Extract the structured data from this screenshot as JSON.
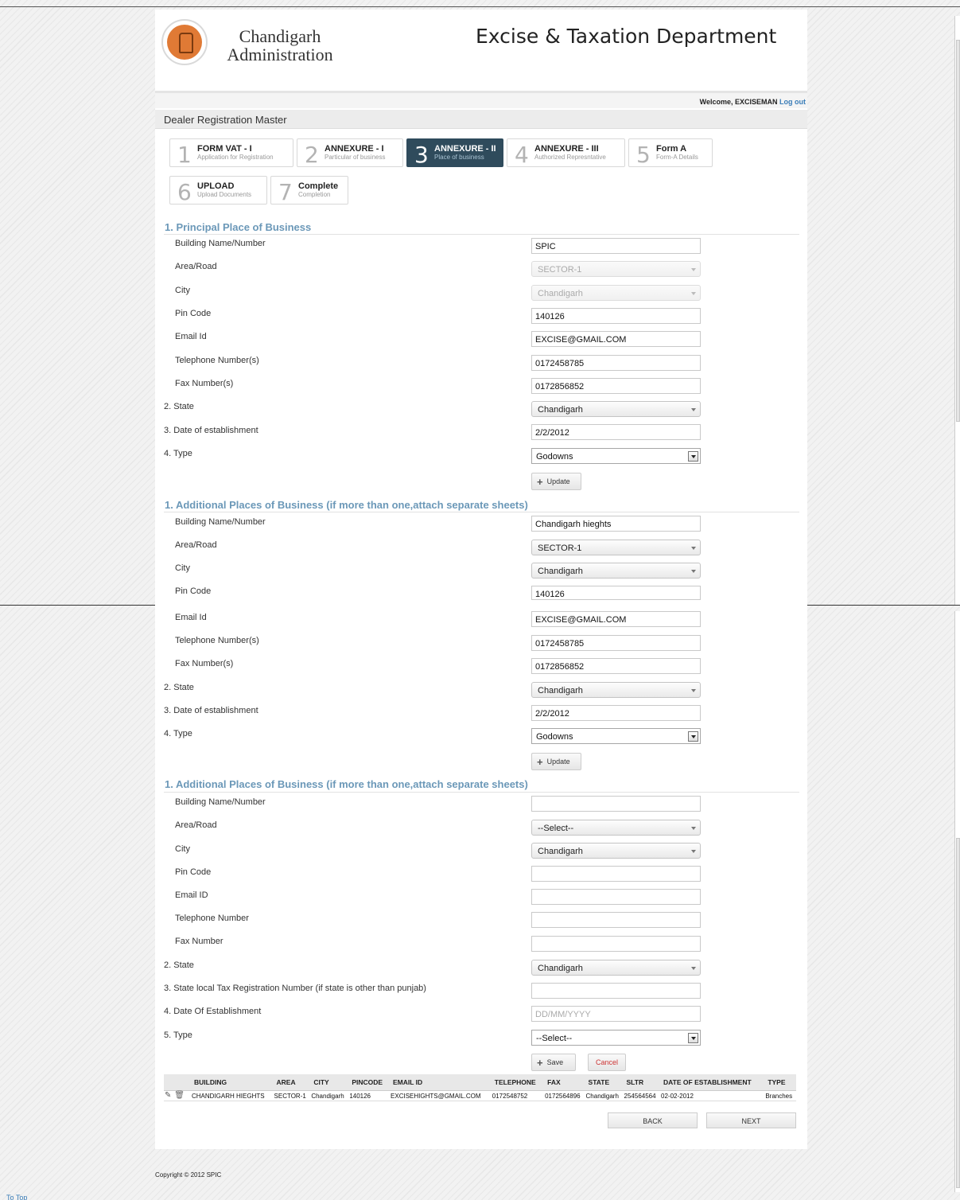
{
  "header": {
    "admin_line1": "Chandigarh",
    "admin_line2": "Administration",
    "department": "Excise & Taxation Department"
  },
  "welcome": {
    "text": "Welcome, EXCISEMAN",
    "logout": "Log out"
  },
  "page_title": "Dealer Registration Master",
  "steps": [
    {
      "num": "1",
      "title": "FORM VAT - I",
      "sub": "Application for Registration"
    },
    {
      "num": "2",
      "title": "ANNEXURE - I",
      "sub": "Particular of business"
    },
    {
      "num": "3",
      "title": "ANNEXURE - II",
      "sub": "Place of business"
    },
    {
      "num": "4",
      "title": "ANNEXURE - III",
      "sub": "Authorized Represntative"
    },
    {
      "num": "5",
      "title": "Form A",
      "sub": "Form-A Details"
    },
    {
      "num": "6",
      "title": "UPLOAD",
      "sub": "Upload Documents"
    },
    {
      "num": "7",
      "title": "Complete",
      "sub": "Completion"
    }
  ],
  "principal": {
    "heading": "1. Principal Place of Business",
    "labels": {
      "building": "Building Name/Number",
      "area": "Area/Road",
      "city": "City",
      "pin": "Pin Code",
      "email": "Email Id",
      "tel": "Telephone Number(s)",
      "fax": "Fax Number(s)",
      "state": "2. State",
      "date": "3. Date of establishment",
      "type": "4. Type"
    },
    "values": {
      "building": "SPIC",
      "area": "SECTOR-1",
      "city": "Chandigarh",
      "pin": "140126",
      "email": "EXCISE@GMAIL.COM",
      "tel": "0172458785",
      "fax": "0172856852",
      "state": "Chandigarh",
      "date": "2/2/2012",
      "type": "Godowns"
    },
    "update": "Update"
  },
  "additional1": {
    "heading": "1. Additional Places of Business (if more than one,attach separate sheets)",
    "labels": {
      "building": "Building Name/Number",
      "area": "Area/Road",
      "city": "City",
      "pin": "Pin Code"
    },
    "values": {
      "building": "Chandigarh hieghts",
      "area": "SECTOR-1",
      "city": "Chandigarh",
      "pin": "140126"
    }
  },
  "continued": {
    "labels": {
      "email": "Email Id",
      "tel": "Telephone Number(s)",
      "fax": "Fax Number(s)",
      "state": "2. State",
      "date": "3. Date of establishment",
      "type": "4. Type"
    },
    "values": {
      "email": "EXCISE@GMAIL.COM",
      "tel": "0172458785",
      "fax": "0172856852",
      "state": "Chandigarh",
      "date": "2/2/2012",
      "type": "Godowns"
    },
    "update": "Update"
  },
  "additional2": {
    "heading": "1. Additional Places of Business (if more than one,attach separate sheets)",
    "labels": {
      "building": "Building Name/Number",
      "area": "Area/Road",
      "city": "City",
      "pin": "Pin Code",
      "email": "Email ID",
      "tel": "Telephone Number",
      "fax": "Fax Number",
      "state": "2. State",
      "sltr": "3. State local Tax Registration Number (if state is other than punjab)",
      "date": "4. Date Of Establishment",
      "type": "5. Type"
    },
    "values": {
      "area": "--Select--",
      "city": "Chandigarh",
      "state": "Chandigarh",
      "type": "--Select--"
    },
    "placeholders": {
      "date": "DD/MM/YYYY"
    },
    "save": "Save",
    "cancel": "Cancel"
  },
  "grid": {
    "headers": [
      "BUILDING",
      "AREA",
      "CITY",
      "PINCODE",
      "EMAIL ID",
      "TELEPHONE",
      "FAX",
      "STATE",
      "SLTR",
      "DATE OF ESTABLISHMENT",
      "TYPE"
    ],
    "rows": [
      [
        "CHANDIGARH HIEGHTS",
        "SECTOR-1",
        "Chandigarh",
        "140126",
        "EXCISEHIGHTS@GMAIL.COM",
        "0172548752",
        "0172564896",
        "Chandigarh",
        "254564564",
        "02-02-2012",
        "Branches"
      ]
    ]
  },
  "nav": {
    "back": "BACK",
    "next": "NEXT"
  },
  "footer": {
    "copyright": "Copyright © 2012 SPIC",
    "to_top": "To Top"
  },
  "colors": {
    "accent": "#6b98b8",
    "active_step": "#2f4b5c",
    "link": "#3a7db8",
    "logo": "#e07a35"
  }
}
